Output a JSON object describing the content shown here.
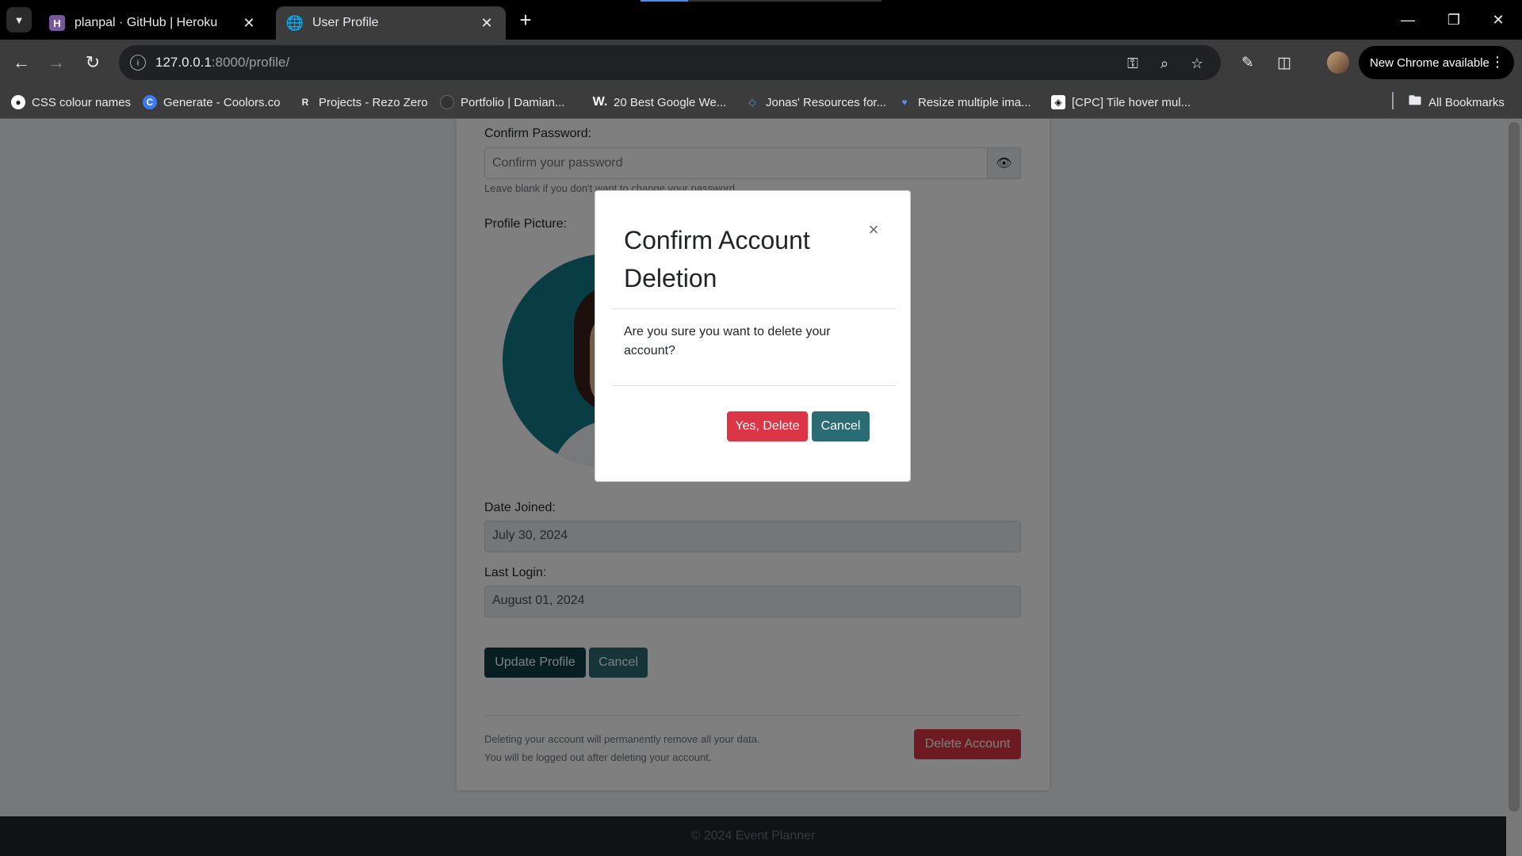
{
  "browser": {
    "tabs": [
      {
        "title": "planpal · GitHub | Heroku",
        "icon": "heroku-icon",
        "active": false
      },
      {
        "title": "User Profile",
        "icon": "globe-icon",
        "active": true
      }
    ],
    "url_host": "127.0.0.1",
    "url_path": ":8000/profile/",
    "update_label": "New Chrome available",
    "bookmarks": [
      "CSS colour names",
      "Generate - Coolors.co",
      "Projects - Rezo Zero",
      "Portfolio | Damian...",
      "20 Best Google We...",
      "Jonas' Resources for...",
      "Resize multiple ima...",
      "[CPC] Tile hover mul..."
    ],
    "all_bookmarks_label": "All Bookmarks"
  },
  "form": {
    "confirm_password_label": "Confirm Password:",
    "confirm_password_placeholder": "Confirm your password",
    "password_hint": "Leave blank if you don't want to change your password.",
    "profile_picture_label": "Profile Picture:",
    "date_joined_label": "Date Joined:",
    "date_joined_value": "July 30, 2024",
    "last_login_label": "Last Login:",
    "last_login_value": "August 01, 2024",
    "update_button": "Update Profile",
    "cancel_button": "Cancel",
    "delete_note_1": "Deleting your account will permanently remove all your data.",
    "delete_note_2": "You will be logged out after deleting your account.",
    "delete_button": "Delete Account"
  },
  "footer": {
    "text": "© 2024 Event Planner"
  },
  "modal": {
    "title": "Confirm Account Deletion",
    "body": "Are you sure you want to delete your account?",
    "confirm_button": "Yes, Delete",
    "cancel_button": "Cancel",
    "close_symbol": "×"
  },
  "colors": {
    "danger": "#dc3545",
    "primary_dark": "#0f3e44",
    "secondary": "#2b6b73"
  }
}
